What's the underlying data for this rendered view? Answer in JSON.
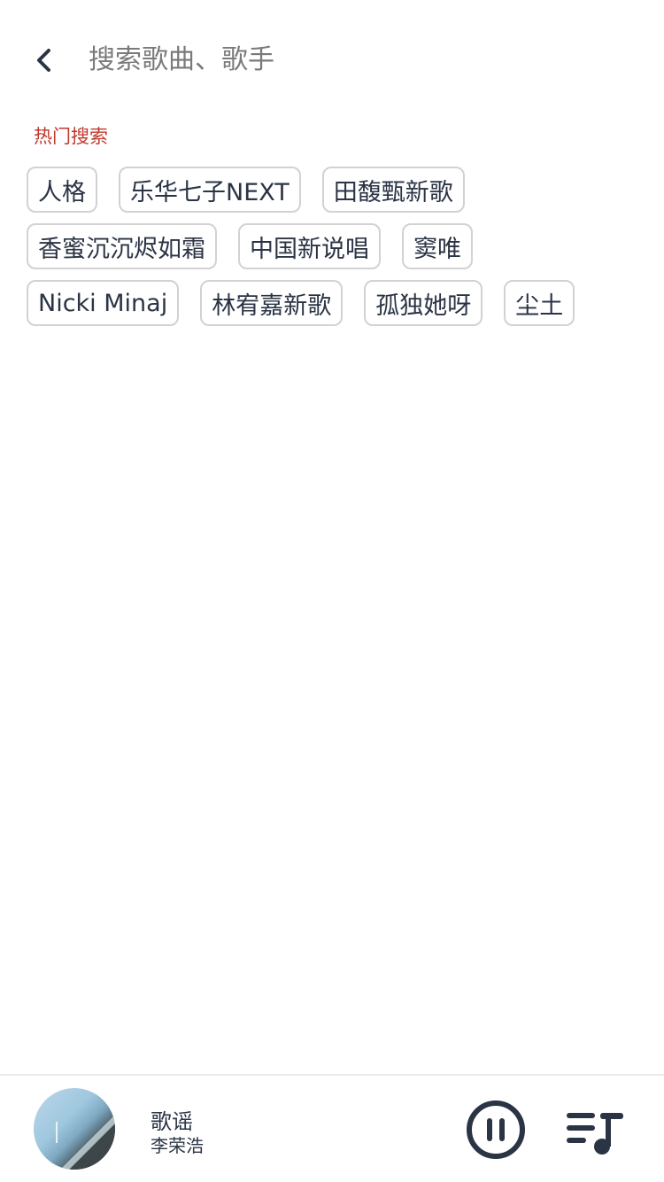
{
  "header": {
    "back_icon": "chevron-left-icon",
    "search_placeholder": "搜索歌曲、歌手",
    "search_value": ""
  },
  "hot_search": {
    "title": "热门搜索",
    "title_color": "#c0392b",
    "rows": [
      [
        "人格",
        "乐华七子NEXT",
        "田馥甄新歌"
      ],
      [
        "香蜜沉沉烬如霜",
        "中国新说唱",
        "窦唯"
      ],
      [
        "Nicki Minaj",
        "林宥嘉新歌",
        "孤独她呀",
        "尘土"
      ]
    ]
  },
  "player": {
    "song_title": "歌谣",
    "artist": "李荣浩",
    "pause_icon": "pause-circle-icon",
    "playlist_icon": "playlist-music-icon",
    "accent_color": "#2b3445"
  }
}
